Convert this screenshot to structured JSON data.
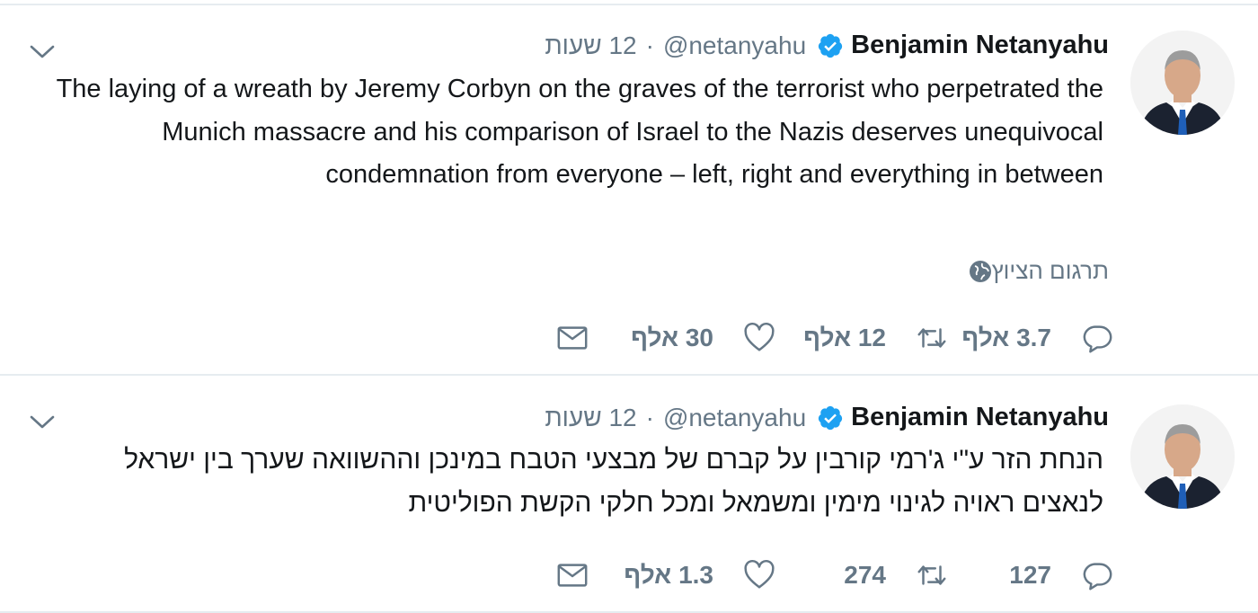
{
  "tweets": [
    {
      "author_name": "Benjamin Netanyahu",
      "handle": "@netanyahu",
      "separator": "·",
      "time": "12 שעות",
      "text": "The laying of a wreath by Jeremy Corbyn on the graves of the terrorist who perpetrated the Munich massacre and his comparison of Israel to the Nazis deserves unequivocal condemnation from everyone – left, right and everything in between",
      "translate_label": "תרגום הציוץ",
      "replies": "3.7 אלף",
      "retweets": "12 אלף",
      "likes": "30 אלף"
    },
    {
      "author_name": "Benjamin Netanyahu",
      "handle": "@netanyahu",
      "separator": "·",
      "time": "12 שעות",
      "text": "הנחת הזר ע\"י ג'רמי קורבין על קברם של מבצעי הטבח במינכן וההשוואה שערך בין ישראל לנאצים ראויה לגינוי מימין ומשמאל ומכל חלקי הקשת הפוליטית",
      "replies": "127",
      "retweets": "274",
      "likes": "1.3 אלף"
    }
  ],
  "colors": {
    "verified": "#1da1f2",
    "muted": "#657786",
    "divider": "#e6ecf0",
    "text": "#14171a"
  },
  "icons": [
    "verified-badge-icon",
    "caret-down-icon",
    "reply-icon",
    "retweet-icon",
    "like-icon",
    "direct-message-icon",
    "globe-icon",
    "avatar-photo"
  ]
}
